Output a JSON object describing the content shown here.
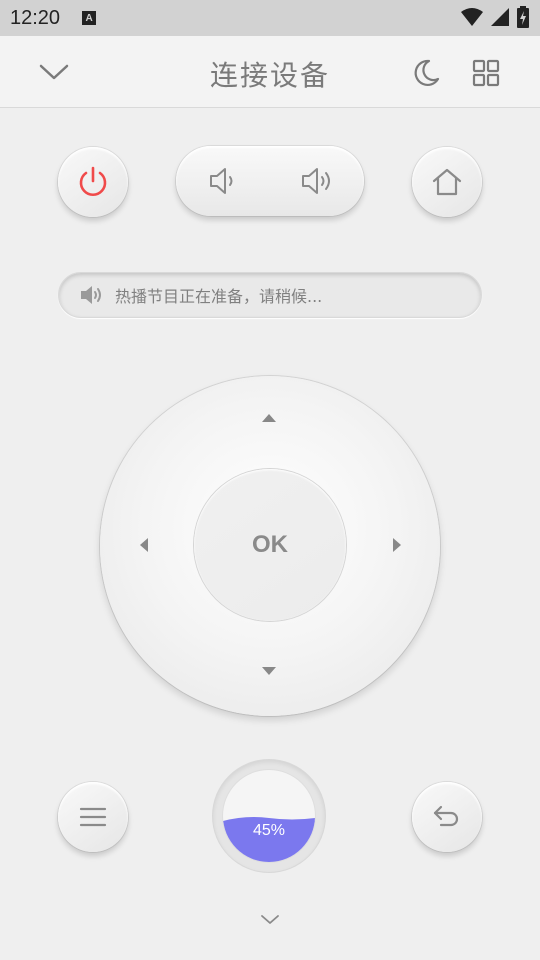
{
  "status_bar": {
    "time": "12:20",
    "notification_icon": "a-icon",
    "wifi_icon": "wifi-icon",
    "signal_icon": "signal-icon",
    "battery_icon": "battery-charging-icon"
  },
  "header": {
    "title": "连接设备",
    "collapse_icon": "chevron-down-icon",
    "night_mode_icon": "moon-icon",
    "apps_icon": "grid-icon"
  },
  "remote": {
    "power_icon": "power-icon",
    "volume_down_icon": "volume-down-icon",
    "volume_up_icon": "volume-up-icon",
    "home_icon": "home-icon",
    "notice_icon": "speaker-icon",
    "notice_text": "热播节目正在准备，请稍候...",
    "ok_label": "OK",
    "menu_icon": "menu-icon",
    "back_icon": "back-icon",
    "expand_icon": "chevron-down-icon"
  },
  "progress": {
    "value": 0.45,
    "label": "45%",
    "color": "#7b78ee"
  },
  "colors": {
    "power": "#f04a4a",
    "icon": "#8a8a8a",
    "background": "#efefef"
  }
}
